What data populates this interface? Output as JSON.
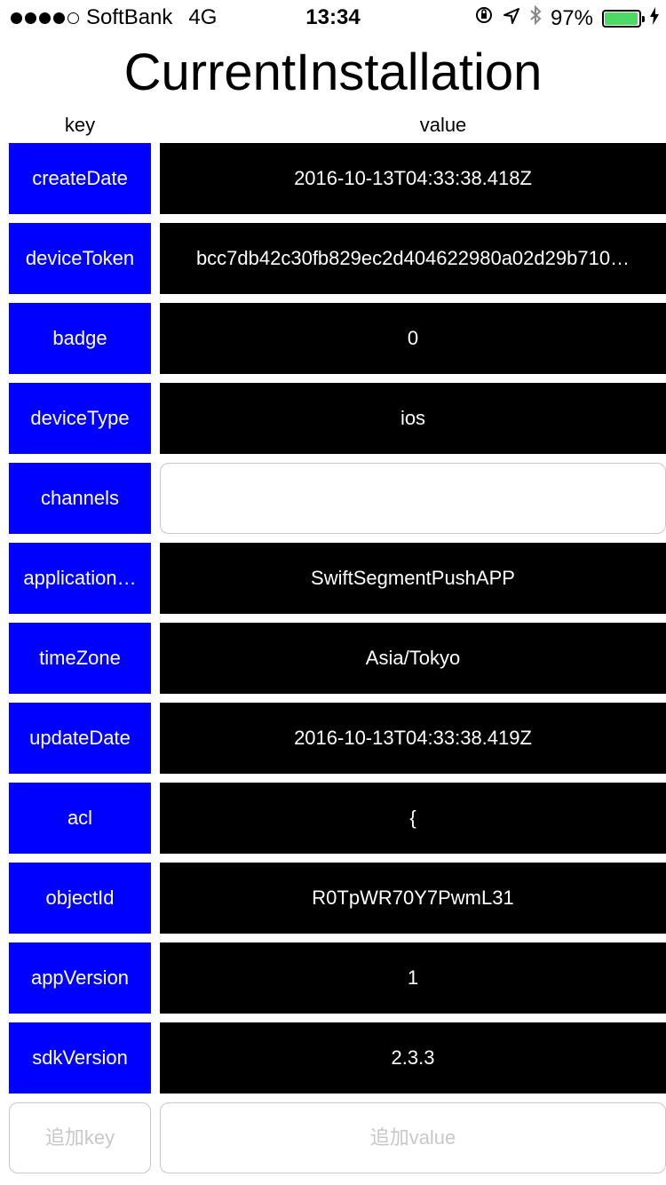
{
  "status_bar": {
    "carrier": "SoftBank",
    "network": "4G",
    "time": "13:34",
    "battery": "97%",
    "battery_level": 0.97,
    "signal_bars_filled": 4,
    "signal_bars_total": 5
  },
  "title": "CurrentInstallation",
  "headers": {
    "key": "key",
    "value": "value"
  },
  "rows": [
    {
      "key": "createDate",
      "value": "2016-10-13T04:33:38.418Z"
    },
    {
      "key": "deviceToken",
      "value": "bcc7db42c30fb829ec2d404622980a02d29b710…"
    },
    {
      "key": "badge",
      "value": "0"
    },
    {
      "key": "deviceType",
      "value": "ios"
    },
    {
      "key": "channels",
      "value": ""
    },
    {
      "key": "application…",
      "value": "SwiftSegmentPushAPP"
    },
    {
      "key": "timeZone",
      "value": "Asia/Tokyo"
    },
    {
      "key": "updateDate",
      "value": "2016-10-13T04:33:38.419Z"
    },
    {
      "key": "acl",
      "value": "{"
    },
    {
      "key": "objectId",
      "value": "R0TpWR70Y7PwmL31"
    },
    {
      "key": "appVersion",
      "value": "1"
    },
    {
      "key": "sdkVersion",
      "value": "2.3.3"
    }
  ],
  "add": {
    "key_placeholder": "追加key",
    "value_placeholder": "追加value"
  },
  "colors": {
    "key_background": "#0000ff",
    "value_background": "#000000",
    "battery_fill": "#4cd964"
  }
}
